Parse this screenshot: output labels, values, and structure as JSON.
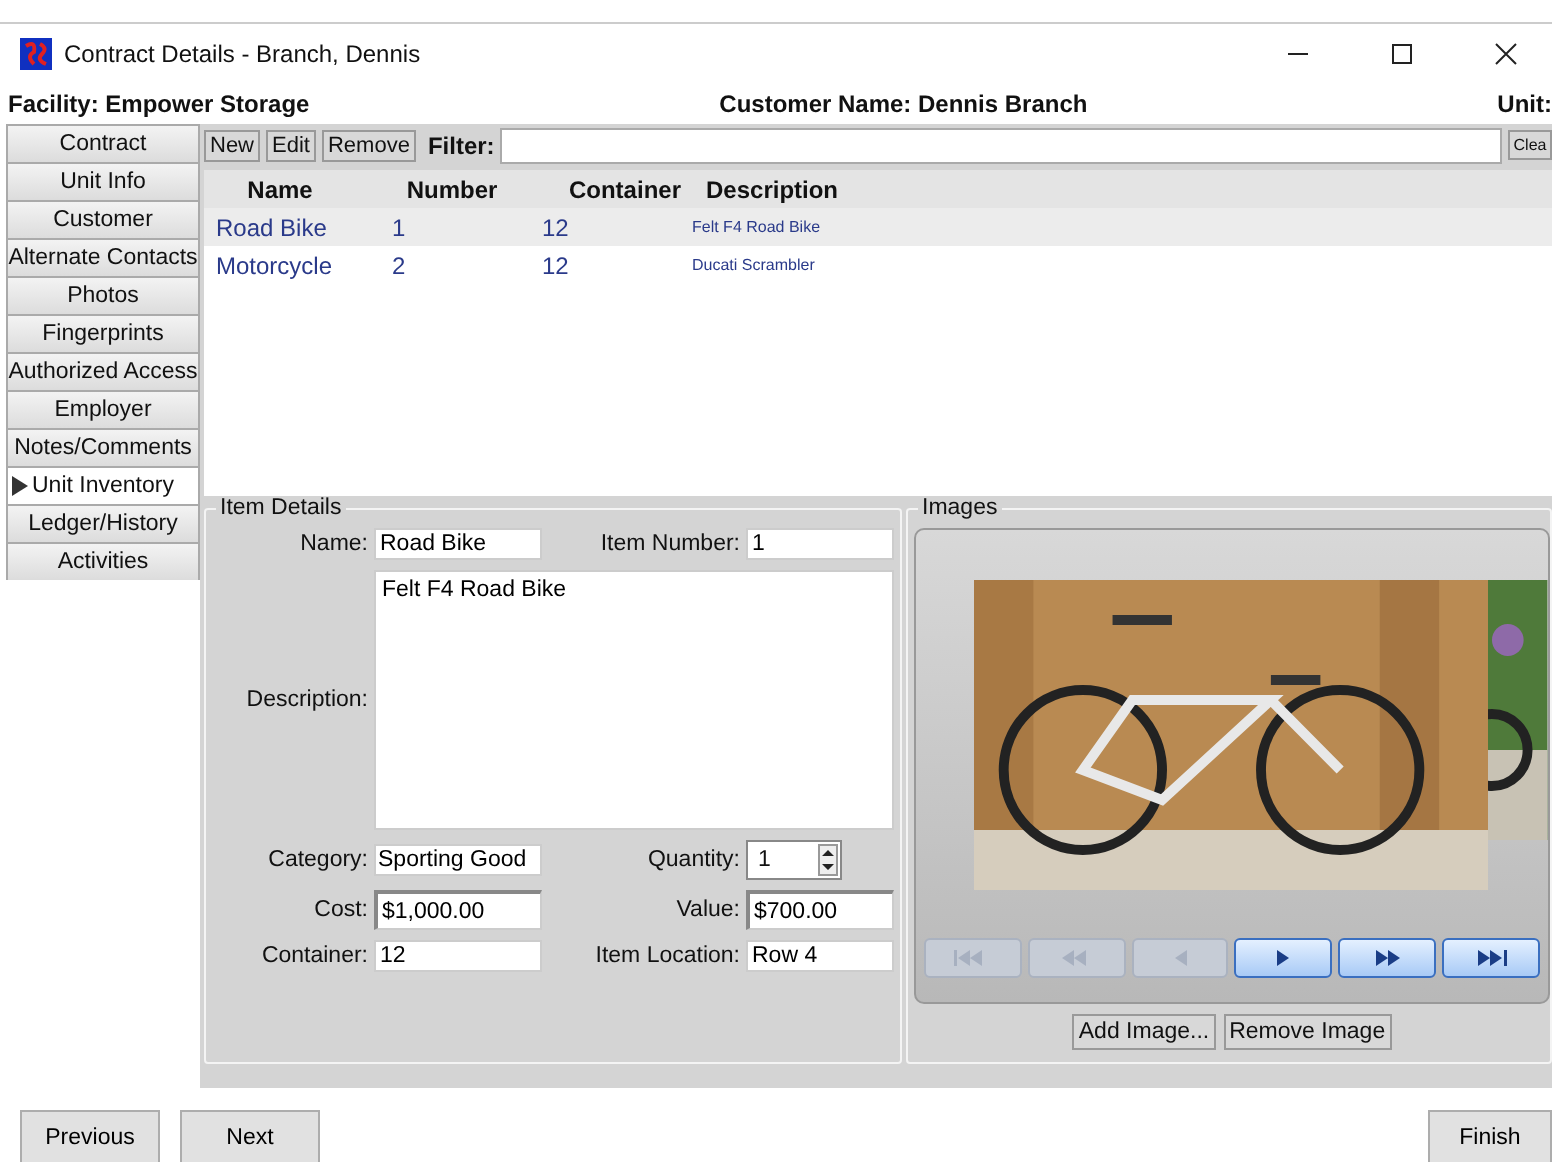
{
  "window": {
    "title": "Contract Details - Branch, Dennis"
  },
  "header": {
    "facility": "Facility: Empower Storage",
    "customer": "Customer Name: Dennis Branch",
    "unit": "Unit:"
  },
  "sidebar": {
    "items": [
      {
        "label": "Contract",
        "selected": false
      },
      {
        "label": "Unit Info",
        "selected": false
      },
      {
        "label": "Customer",
        "selected": false
      },
      {
        "label": "Alternate Contacts",
        "selected": false
      },
      {
        "label": "Photos",
        "selected": false
      },
      {
        "label": "Fingerprints",
        "selected": false
      },
      {
        "label": "Authorized Access",
        "selected": false
      },
      {
        "label": "Employer",
        "selected": false
      },
      {
        "label": "Notes/Comments",
        "selected": false
      },
      {
        "label": "Unit Inventory",
        "selected": true
      },
      {
        "label": "Ledger/History",
        "selected": false
      },
      {
        "label": "Activities",
        "selected": false
      }
    ]
  },
  "toolbar": {
    "buttons": [
      "New",
      "Edit",
      "Remove"
    ],
    "filter_label": "Filter:",
    "clear_button": "Clea"
  },
  "table": {
    "columns": [
      "Name",
      "Number",
      "Container",
      "Description"
    ],
    "rows": [
      {
        "cells": [
          "Road Bike",
          "1",
          "12",
          "Felt F4 Road Bike"
        ],
        "selected": true
      },
      {
        "cells": [
          "Motorcycle",
          "2",
          "12",
          "Ducati Scrambler"
        ],
        "selected": false
      }
    ]
  },
  "item_details": {
    "title": "Item Details",
    "name_label": "Name:",
    "name": "Road Bike",
    "item_number_label": "Item Number:",
    "item_number": "1",
    "description_label": "Description:",
    "description": "Felt F4 Road Bike",
    "category_label": "Category:",
    "category": "Sporting Good",
    "quantity_label": "Quantity:",
    "quantity": "1",
    "cost_label": "Cost:",
    "cost": "$1,000.00",
    "value_label": "Value:",
    "value": "$700.00",
    "container_label": "Container:",
    "container": "12",
    "location_label": "Item Location:",
    "location": "Row 4"
  },
  "images": {
    "title": "Images",
    "viewer_buttons": [
      {
        "kind": "first",
        "disabled": true
      },
      {
        "kind": "previous",
        "disabled": true
      },
      {
        "kind": "back",
        "disabled": true
      },
      {
        "kind": "play",
        "disabled": false
      },
      {
        "kind": "forward",
        "disabled": false
      },
      {
        "kind": "last",
        "disabled": false
      }
    ],
    "buttons": [
      "Add Image...",
      "Remove Image"
    ]
  },
  "footer": {
    "previous": "Previous",
    "next": "Next",
    "finish": "Finish"
  }
}
